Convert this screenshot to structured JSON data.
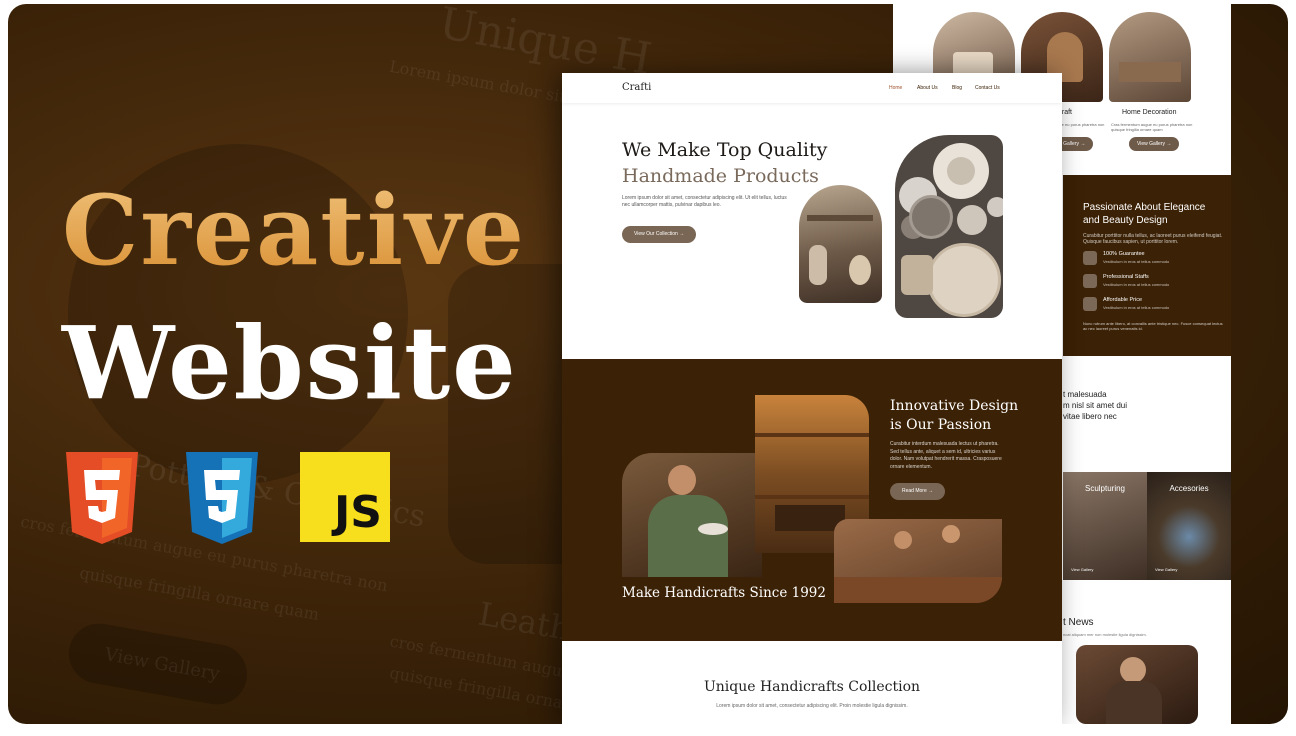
{
  "banner": {
    "title_line1": "Creative",
    "title_line2": "Website",
    "tech_badges": [
      {
        "name": "html5-icon",
        "label": "5",
        "color": "#e44d26"
      },
      {
        "name": "css3-icon",
        "label": "3",
        "color": "#1572b6"
      },
      {
        "name": "javascript-icon",
        "label": "JS",
        "color": "#f7df1e"
      }
    ],
    "background_ghost_text": [
      "Unique H",
      "Lorem ipsum dolor sit ar",
      "Pottery & Ceramics",
      "cros fermentum augue eu purus pharetra non",
      "quisque fringilla ornare quam",
      "Leathe",
      "cros fermentum augue eu purus",
      "quisque fringilla ornare quam",
      "View Gallery"
    ]
  },
  "main_page": {
    "logo": "Crafti",
    "nav": [
      "Home",
      "About Us",
      "Blog",
      "Contact Us"
    ],
    "hero": {
      "heading_line1": "We Make Top Quality",
      "heading_line2": "Handmade Products",
      "paragraph": "Lorem ipsum dolor sit amet, consectetur adipiscing elit. Ut elit tellus, luctus nec ullamcorper mattis, pulvinar dapibus leo.",
      "button": "View Our Collection →"
    },
    "passion": {
      "heading_line1": "Innovative Design",
      "heading_line2": "is Our Passion",
      "paragraph": "Curabitur interdum malesuada lectus ut pharetra. Sed tellus ante, aliquet a sem id, ultricies varius dolor. Nam volutpat hendrerit massa. Crasposuere ornare elementum.",
      "button": "Read More →",
      "since": "Make Handicrafts Since 1992"
    },
    "collection": {
      "heading": "Unique Handicrafts Collection",
      "paragraph": "Lorem ipsum dolor sit amet, consectetur adipiscing elit. Proin molestie ligula dignissim."
    }
  },
  "back_page": {
    "cards": [
      {
        "label": "e Craft",
        "text": "Cras fermentum augue eu purus pharetra non",
        "button": "View Gallery →"
      },
      {
        "label": "Home Decoration",
        "text": "Cras fermentum augue eu purus pharetra non quisque fringilla ornare quam",
        "button": "View Gallery →"
      }
    ],
    "elegance": {
      "heading": "Passionate About Elegance and Beauty Design",
      "paragraph": "Curabitur porttitor nulla tellus, ac laoreet purus eleifend feugiat. Quisque faucibus sapien, ut porttitor lorem.",
      "features": [
        {
          "title": "100% Guarantee",
          "text": "Vestibulum in eros at tellus commodo"
        },
        {
          "title": "Professional Staffs",
          "text": "Vestibulum in eros at tellus commodo"
        },
        {
          "title": "Affordable Price",
          "text": "Vestibulum in eros at tellus commodo"
        }
      ],
      "footnote": "Nunc rutrum ante libero, at convallis ante tristique nec. Fusce consequat lectus ac nec laoreet purus venenatis id."
    },
    "partial_text": [
      "t malesuada",
      "m nisl sit amet dui",
      "vitae libero nec"
    ],
    "tiles": [
      {
        "label": "Sculpturing",
        "button": "View Gallery"
      },
      {
        "label": "Accesories",
        "button": "View Gallery"
      }
    ],
    "news": {
      "heading": "t News",
      "text": "ncat aliquam mer non molestie ligula dignissim."
    }
  }
}
